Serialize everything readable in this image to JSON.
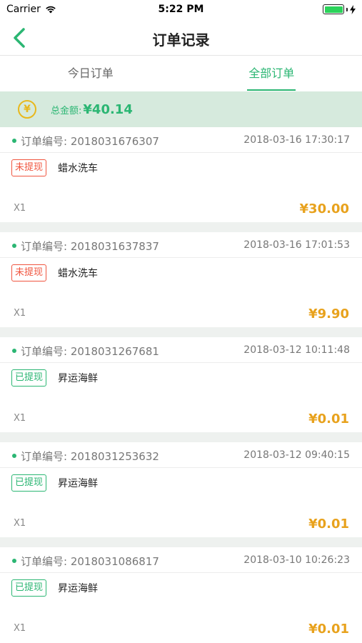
{
  "status_bar": {
    "carrier": "Carrier",
    "time": "5:22 PM"
  },
  "nav": {
    "title": "订单记录",
    "back_icon": "chevron-left-icon"
  },
  "tabs": [
    {
      "label": "今日订单",
      "active": false
    },
    {
      "label": "全部订单",
      "active": true
    }
  ],
  "summary": {
    "label": "总金额:",
    "value": "¥40.14",
    "coin_glyph": "¥"
  },
  "orders": [
    {
      "label": "订单编号:",
      "number": "2018031676307",
      "time": "2018-03-16 17:30:17",
      "status": "未提现",
      "status_type": "pending",
      "shop": "蜡水洗车",
      "qty": "X1",
      "price": "¥30.00"
    },
    {
      "label": "订单编号:",
      "number": "2018031637837",
      "time": "2018-03-16 17:01:53",
      "status": "未提现",
      "status_type": "pending",
      "shop": "蜡水洗车",
      "qty": "X1",
      "price": "¥9.90"
    },
    {
      "label": "订单编号:",
      "number": "2018031267681",
      "time": "2018-03-12 10:11:48",
      "status": "已提现",
      "status_type": "done",
      "shop": "昇运海鲜",
      "qty": "X1",
      "price": "¥0.01"
    },
    {
      "label": "订单编号:",
      "number": "2018031253632",
      "time": "2018-03-12 09:40:15",
      "status": "已提现",
      "status_type": "done",
      "shop": "昇运海鲜",
      "qty": "X1",
      "price": "¥0.01"
    },
    {
      "label": "订单编号:",
      "number": "2018031086817",
      "time": "2018-03-10 10:26:23",
      "status": "已提现",
      "status_type": "done",
      "shop": "昇运海鲜",
      "qty": "X1",
      "price": "¥0.01"
    }
  ],
  "colors": {
    "accent": "#2bb673",
    "price": "#e8a21d",
    "pending": "#f0553f",
    "summary_bg": "#d6eadd"
  }
}
